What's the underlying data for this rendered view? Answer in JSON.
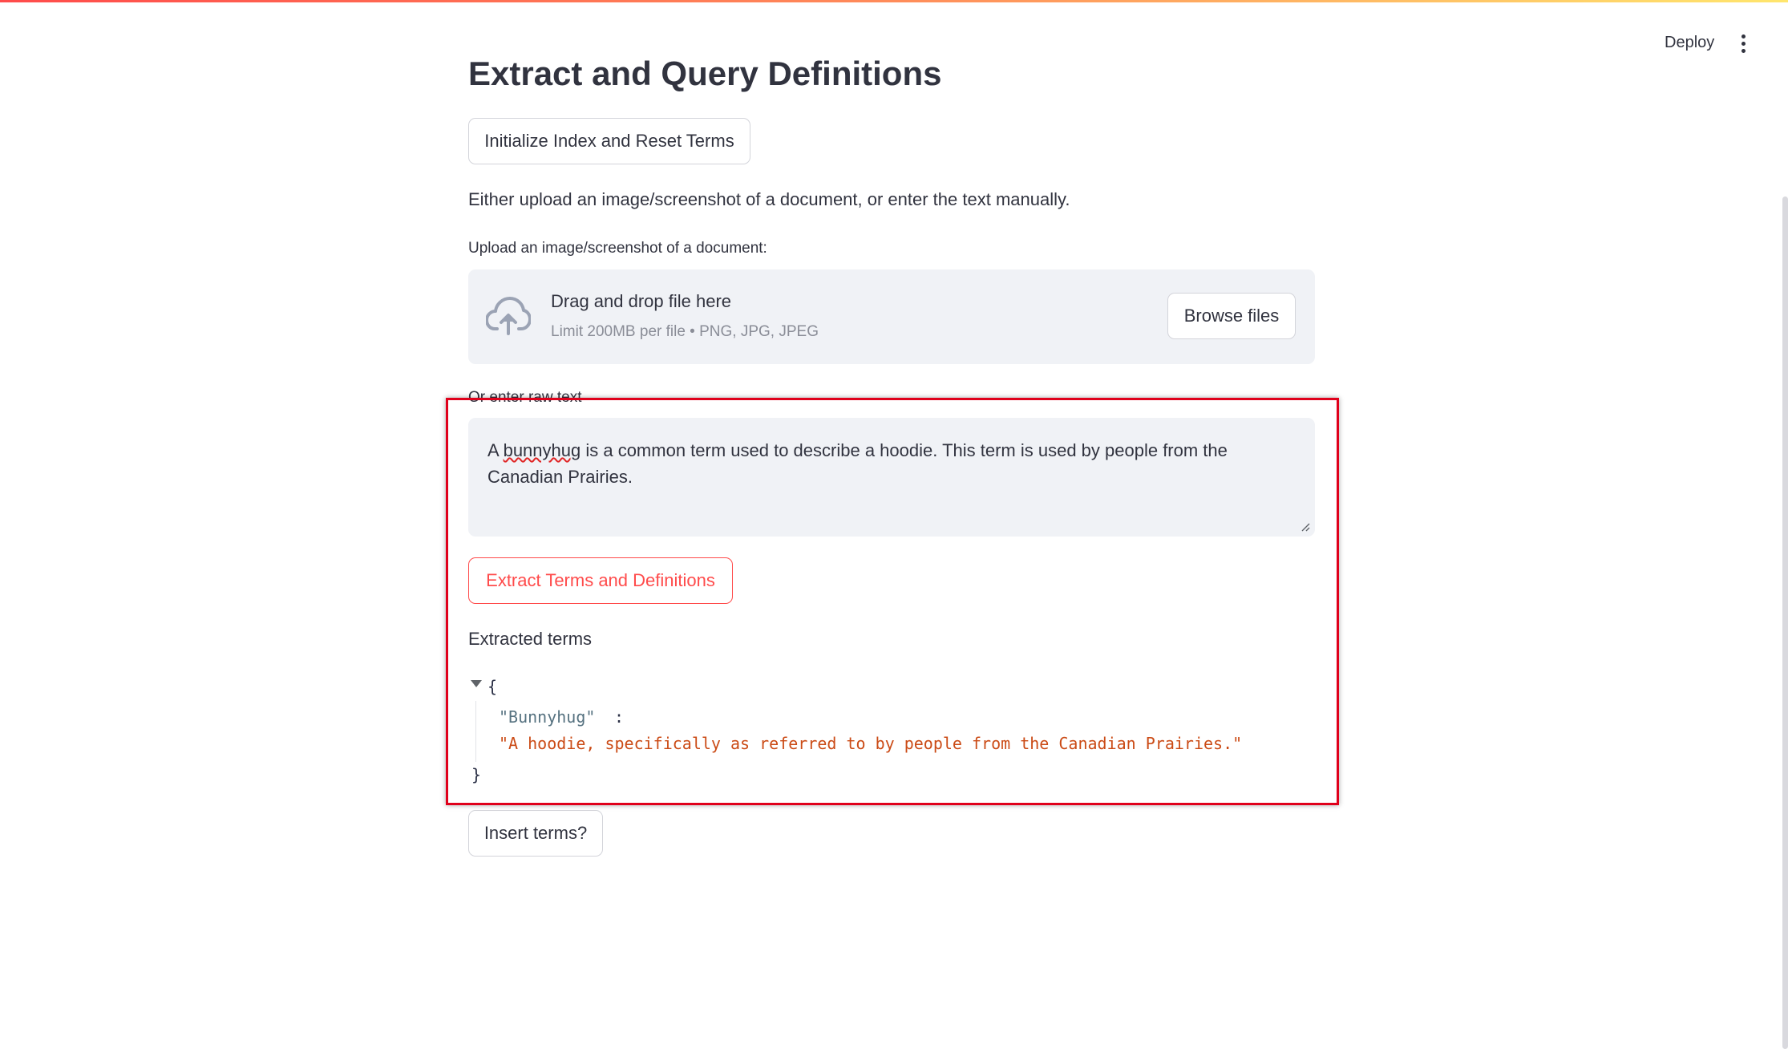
{
  "header": {
    "deploy_label": "Deploy",
    "menu_icon": "kebab-menu-icon"
  },
  "main": {
    "title": "Extract and Query Definitions",
    "init_button_label": "Initialize Index and Reset Terms",
    "instructions": "Either upload an image/screenshot of a document, or enter the text manually.",
    "uploader": {
      "label": "Upload an image/screenshot of a document:",
      "icon": "cloud-upload-icon",
      "drop_title": "Drag and drop file here",
      "limit_text": "Limit 200MB per file • PNG, JPG, JPEG",
      "browse_label": "Browse files"
    },
    "raw_text": {
      "label": "Or enter raw text",
      "value_prefix": "A ",
      "value_misspelled": "bunnyhug",
      "value_rest_line1": " is a common term used to describe a hoodie. This term is used by people from the",
      "value_line2": "Canadian Prairies."
    },
    "extract_button_label": "Extract Terms and Definitions",
    "extracted_label": "Extracted terms",
    "json_view": {
      "open_brace": "{",
      "close_brace": "}",
      "key": "\"Bunnyhug\"",
      "colon": ":",
      "value": "\"A hoodie, specifically as referred to by people from the Canadian Prairies.\""
    },
    "insert_button_label": "Insert terms?"
  },
  "colors": {
    "accent": "#ff4b4b",
    "highlight_box": "#e0001b",
    "json_value": "#cb4b16",
    "json_key": "#567280"
  }
}
